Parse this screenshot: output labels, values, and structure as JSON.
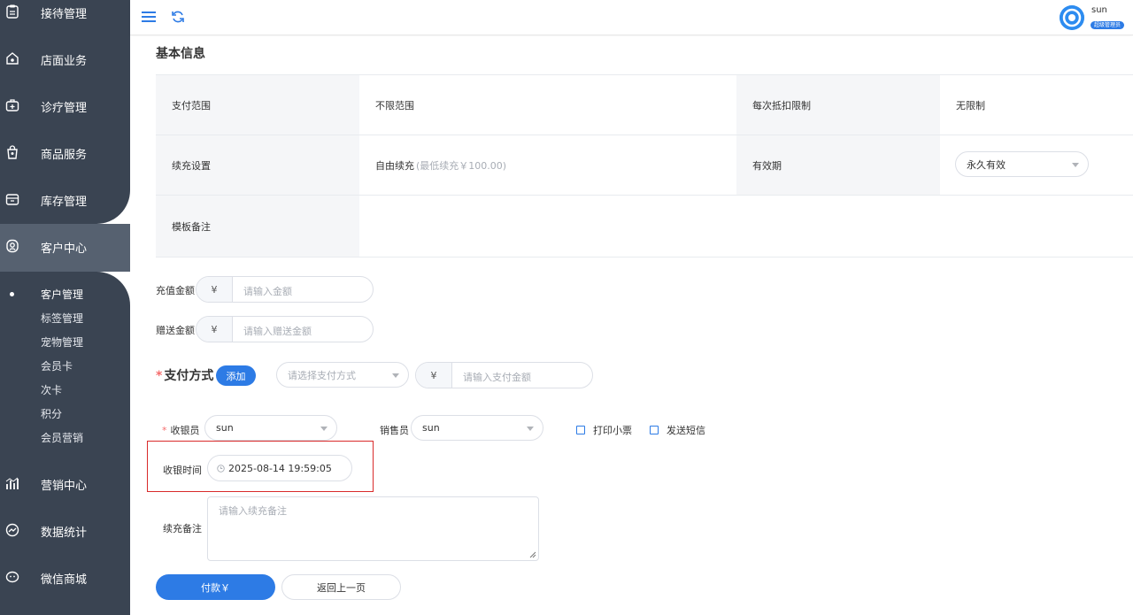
{
  "sidebar": {
    "nav": [
      {
        "label": "接待管理",
        "icon": "clipboard-icon"
      },
      {
        "label": "店面业务",
        "icon": "store-icon"
      },
      {
        "label": "诊疗管理",
        "icon": "medical-kit-icon"
      },
      {
        "label": "商品服务",
        "icon": "shopping-bag-icon"
      },
      {
        "label": "库存管理",
        "icon": "inventory-box-icon"
      },
      {
        "label": "客户中心",
        "icon": "customer-icon",
        "active": true
      },
      {
        "label": "营销中心",
        "icon": "bar-chart-icon"
      },
      {
        "label": "数据统计",
        "icon": "trend-icon"
      },
      {
        "label": "微信商城",
        "icon": "wechat-icon"
      }
    ],
    "sub_items": [
      "客户管理",
      "标签管理",
      "宠物管理",
      "会员卡",
      "次卡",
      "积分",
      "会员营销"
    ],
    "active_sub": "客户管理"
  },
  "header": {
    "user_name": "sun",
    "user_role": "超级管理员"
  },
  "main": {
    "section_title": "基本信息",
    "info": {
      "pay_scope_label": "支付范围",
      "pay_scope_value": "不限范围",
      "deduct_limit_label": "每次抵扣限制",
      "deduct_limit_value": "无限制",
      "recharge_setting_label": "续充设置",
      "recharge_setting_value": "自由续充",
      "recharge_setting_note": "(最低续充￥100.00)",
      "validity_label": "有效期",
      "validity_value": "永久有效",
      "template_note_label": "模板备注",
      "template_note_value": ""
    },
    "recharge_amount": {
      "label": "充值金额",
      "prefix": "¥",
      "placeholder": "请输入金额"
    },
    "gift_amount": {
      "label": "赠送金额",
      "prefix": "¥",
      "placeholder": "请输入赠送金额"
    },
    "payment": {
      "title": "支付方式",
      "add_label": "添加",
      "method_placeholder": "请选择支付方式",
      "amount_prefix": "¥",
      "amount_placeholder": "请输入支付金额"
    },
    "cashier": {
      "label": "收银员",
      "value": "sun"
    },
    "salesperson": {
      "label": "销售员",
      "value": "sun"
    },
    "print_receipt": {
      "label": "打印小票",
      "checked": false
    },
    "send_sms": {
      "label": "发送短信",
      "checked": false
    },
    "cashier_time": {
      "label": "收银时间",
      "value": "2025-08-14 19:59:05"
    },
    "recharge_note": {
      "label": "续充备注",
      "placeholder": "请输入续充备注"
    },
    "pay_button": "付款￥",
    "back_button": "返回上一页"
  },
  "colors": {
    "primary": "#2d7be5",
    "sidebar_bg": "#3a4452",
    "sidebar_active": "#566170",
    "highlight_border": "#d92b2b"
  }
}
